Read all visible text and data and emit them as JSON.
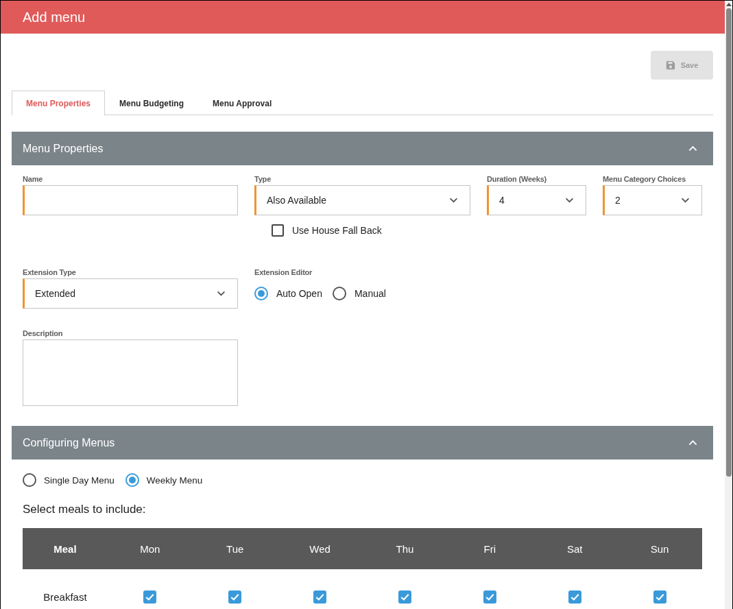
{
  "window": {
    "title": "Add menu"
  },
  "save_button": {
    "label": "Save",
    "disabled": true
  },
  "tabs": [
    {
      "label": "Menu Properties",
      "selected": true
    },
    {
      "label": "Menu Budgeting",
      "selected": false
    },
    {
      "label": "Menu Approval",
      "selected": false
    }
  ],
  "menu_properties": {
    "title": "Menu Properties",
    "expanded": true,
    "rows": [
      [
        {
          "kind": "text",
          "label": "Name",
          "required": true
        },
        {
          "kind": "select",
          "label": "Type",
          "value": "Also Available",
          "required": true,
          "checkbox": {
            "label": "Use House Fall Back",
            "checked": false
          }
        },
        {
          "kind": "select",
          "label": "Duration (Weeks)",
          "value": "4",
          "required": true
        },
        {
          "kind": "select",
          "label": "Menu Category Choices",
          "value": "2",
          "required": true
        }
      ],
      [
        {
          "kind": "select",
          "label": "Extension Type",
          "value": "Extended",
          "required": true
        },
        {
          "kind": "radio",
          "label": "Extension Editor",
          "options": [
            {
              "label": "Auto Open",
              "selected": true
            },
            {
              "label": "Manual",
              "selected": false
            }
          ]
        }
      ],
      [
        {
          "kind": "textarea",
          "label": "Description",
          "required": false
        }
      ]
    ]
  },
  "configuring_menus": {
    "title": "Configuring Menus",
    "expanded": true,
    "menu_mode": [
      {
        "label": "Single Day Menu",
        "selected": false
      },
      {
        "label": "Weekly Menu",
        "selected": true
      }
    ],
    "prompt": "Select meals to include:",
    "table": {
      "columns": [
        "Meal",
        "Mon",
        "Tue",
        "Wed",
        "Thu",
        "Fri",
        "Sat",
        "Sun"
      ],
      "rows": [
        {
          "meal": "Breakfast",
          "days": [
            {
              "checked": true
            },
            {
              "checked": true
            },
            {
              "checked": true
            },
            {
              "checked": true
            },
            {
              "checked": true
            },
            {
              "checked": true
            },
            {
              "checked": true
            }
          ]
        }
      ]
    }
  }
}
